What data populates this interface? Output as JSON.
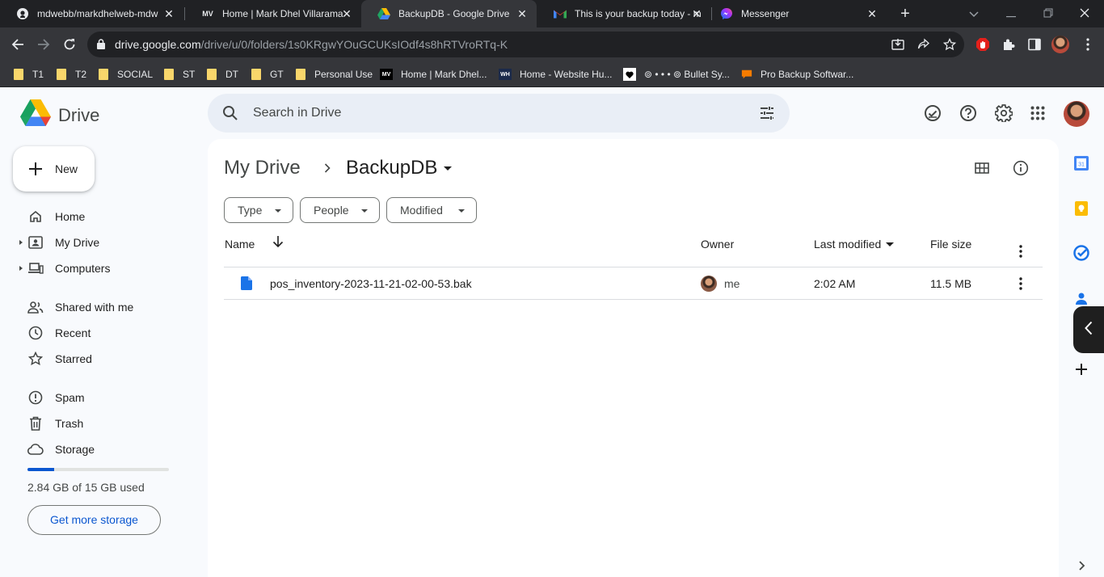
{
  "browser": {
    "tabs": [
      {
        "title": "mdwebb/markdhelweb-mdw",
        "icon": "github-icon",
        "active": false
      },
      {
        "title": "Home | Mark Dhel Villarama",
        "icon": "mv-icon",
        "active": false
      },
      {
        "title": "BackupDB - Google Drive",
        "icon": "google-drive-icon",
        "active": true
      },
      {
        "title": "This is your backup today - m",
        "icon": "gmail-icon",
        "active": false
      },
      {
        "title": "Messenger",
        "icon": "messenger-icon",
        "active": false
      }
    ],
    "url_host": "drive.google.com",
    "url_path": "/drive/u/0/folders/1s0KRgwYOuGCUKsIOdf4s8hRTVroRTq-K",
    "bookmarks": [
      {
        "label": "T1",
        "icon": "folder-icon"
      },
      {
        "label": "T2",
        "icon": "folder-icon"
      },
      {
        "label": "SOCIAL",
        "icon": "folder-icon"
      },
      {
        "label": "ST",
        "icon": "folder-icon"
      },
      {
        "label": "DT",
        "icon": "folder-icon"
      },
      {
        "label": "GT",
        "icon": "folder-icon"
      },
      {
        "label": "Personal Use",
        "icon": "folder-icon"
      },
      {
        "label": "Home | Mark Dhel...",
        "icon": "mv-icon"
      },
      {
        "label": "Home - Website Hu...",
        "icon": "wh-icon"
      },
      {
        "label": "⊚ • • • ⊚ Bullet Sy...",
        "icon": "heart-icon"
      },
      {
        "label": "Pro Backup Softwar...",
        "icon": "chat-bubble-icon"
      }
    ]
  },
  "drive": {
    "app_name": "Drive",
    "search_placeholder": "Search in Drive",
    "new_label": "New",
    "nav": [
      {
        "label": "Home",
        "icon": "home-icon"
      },
      {
        "label": "My Drive",
        "icon": "my-drive-icon"
      },
      {
        "label": "Computers",
        "icon": "computers-icon"
      },
      {
        "label": "Shared with me",
        "icon": "shared-icon"
      },
      {
        "label": "Recent",
        "icon": "clock-icon"
      },
      {
        "label": "Starred",
        "icon": "star-icon"
      },
      {
        "label": "Spam",
        "icon": "spam-icon"
      },
      {
        "label": "Trash",
        "icon": "trash-icon"
      },
      {
        "label": "Storage",
        "icon": "cloud-icon"
      }
    ],
    "storage": {
      "used_text": "2.84 GB of 15 GB used",
      "used_fraction": 0.189,
      "button_label": "Get more storage"
    },
    "breadcrumb": {
      "root": "My Drive",
      "current": "BackupDB"
    },
    "filters": [
      {
        "label": "Type"
      },
      {
        "label": "People"
      },
      {
        "label": "Modified"
      }
    ],
    "columns": {
      "name": "Name",
      "owner": "Owner",
      "last_modified": "Last modified",
      "file_size": "File size"
    },
    "files": [
      {
        "name": "pos_inventory-2023-11-21-02-00-53.bak",
        "owner": "me",
        "modified": "2:02 AM",
        "size": "11.5 MB"
      }
    ]
  },
  "colors": {
    "accent": "#0b57d0",
    "chrome_dark": "#202124",
    "chrome_toolbar": "#35363a",
    "drive_bg": "#f8fafd",
    "search_bg": "#e9eef6"
  }
}
